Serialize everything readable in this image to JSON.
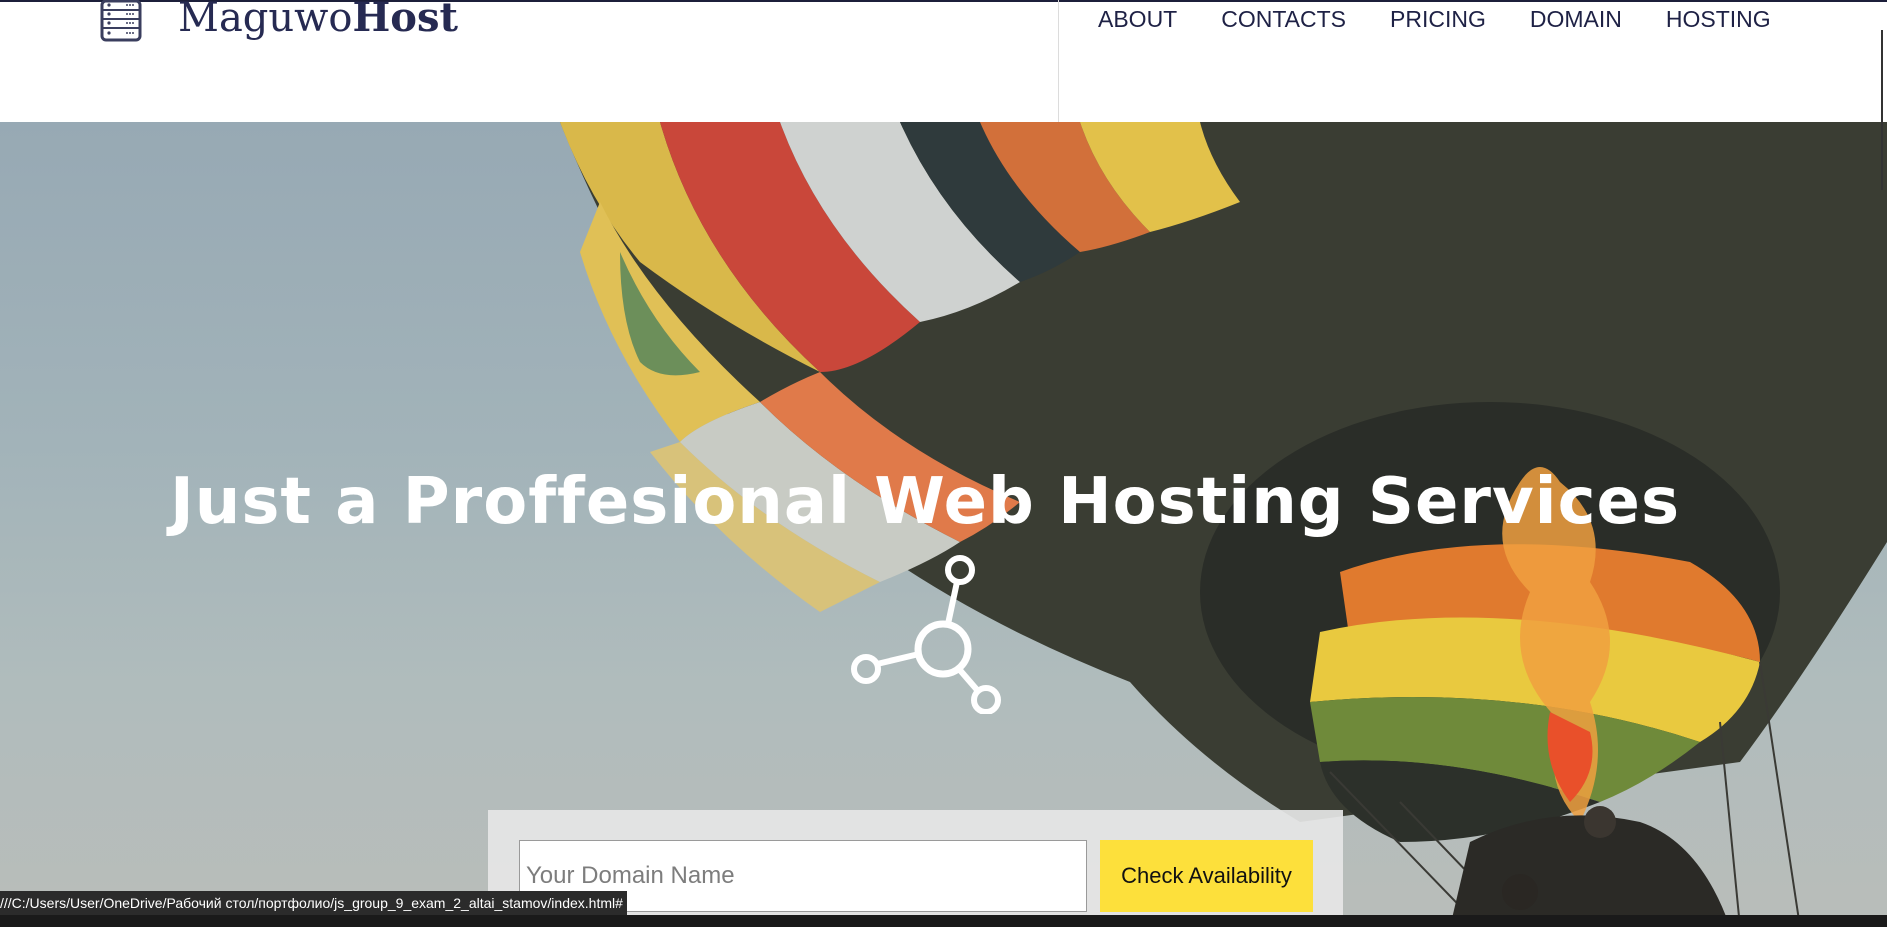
{
  "header": {
    "logo_icon": "server-rack-icon",
    "brand_regular": "Maguwo",
    "brand_bold": "Host",
    "nav": [
      {
        "label": "ABOUT"
      },
      {
        "label": "CONTACTS"
      },
      {
        "label": "PRICING"
      },
      {
        "label": "DOMAIN"
      },
      {
        "label": "HOSTING"
      }
    ]
  },
  "hero": {
    "title": "Just a Proffesional Web Hosting Services",
    "icon": "share-hub-icon",
    "background": "hot-air-balloon-photo"
  },
  "domain_search": {
    "placeholder": "Your Domain Name",
    "value": "",
    "button_label": "Check Availability"
  },
  "status_bar": {
    "url": "///C:/Users/User/OneDrive/Рабочий стол/портфолио/js_group_9_exam_2_altai_stamov/index.html#"
  },
  "colors": {
    "brand": "#262a52",
    "button": "#fde03b",
    "nav_text": "#1e2145",
    "hero_text": "#ffffff"
  }
}
